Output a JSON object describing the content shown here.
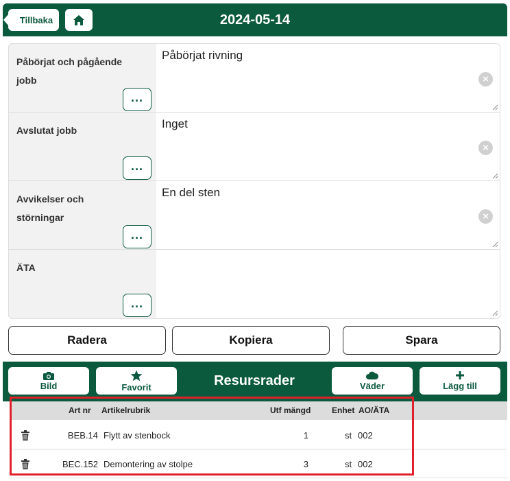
{
  "header": {
    "back_label": "Tillbaka",
    "title": "2024-05-14",
    "home_icon": "home-icon",
    "accent_color": "#0b5a3e"
  },
  "fields": [
    {
      "label_line1": "Påbörjat och pågående",
      "label_line2": "jobb",
      "value": "Påbörjat rivning",
      "dots": "..."
    },
    {
      "label_line1": "Avslutat jobb",
      "label_line2": "",
      "value": "Inget",
      "dots": "..."
    },
    {
      "label_line1": "Avvikelser och störningar",
      "label_line2": "",
      "value": "En del sten",
      "dots": "..."
    },
    {
      "label_line1": "ÄTA",
      "label_line2": "",
      "value": "",
      "dots": "..."
    }
  ],
  "actions": {
    "delete_label": "Radera",
    "copy_label": "Kopiera",
    "save_label": "Spara"
  },
  "resources": {
    "title": "Resursrader",
    "photo_label": "Bild",
    "favorite_label": "Favorit",
    "weather_label": "Väder",
    "add_label": "Lägg till"
  },
  "table": {
    "columns": {
      "art_nr": "Art nr",
      "rubrik": "Artikelrubrik",
      "mangd": "Utf mängd",
      "enhet": "Enhet",
      "ao": "AO/ÄTA"
    },
    "rows": [
      {
        "art_nr": "BEB.14",
        "rubrik": "Flytt av stenbock",
        "mangd": "1",
        "enhet": "st",
        "ao": "002"
      },
      {
        "art_nr": "BEC.152",
        "rubrik": "Demontering av stolpe",
        "mangd": "3",
        "enhet": "st",
        "ao": "002"
      }
    ]
  }
}
